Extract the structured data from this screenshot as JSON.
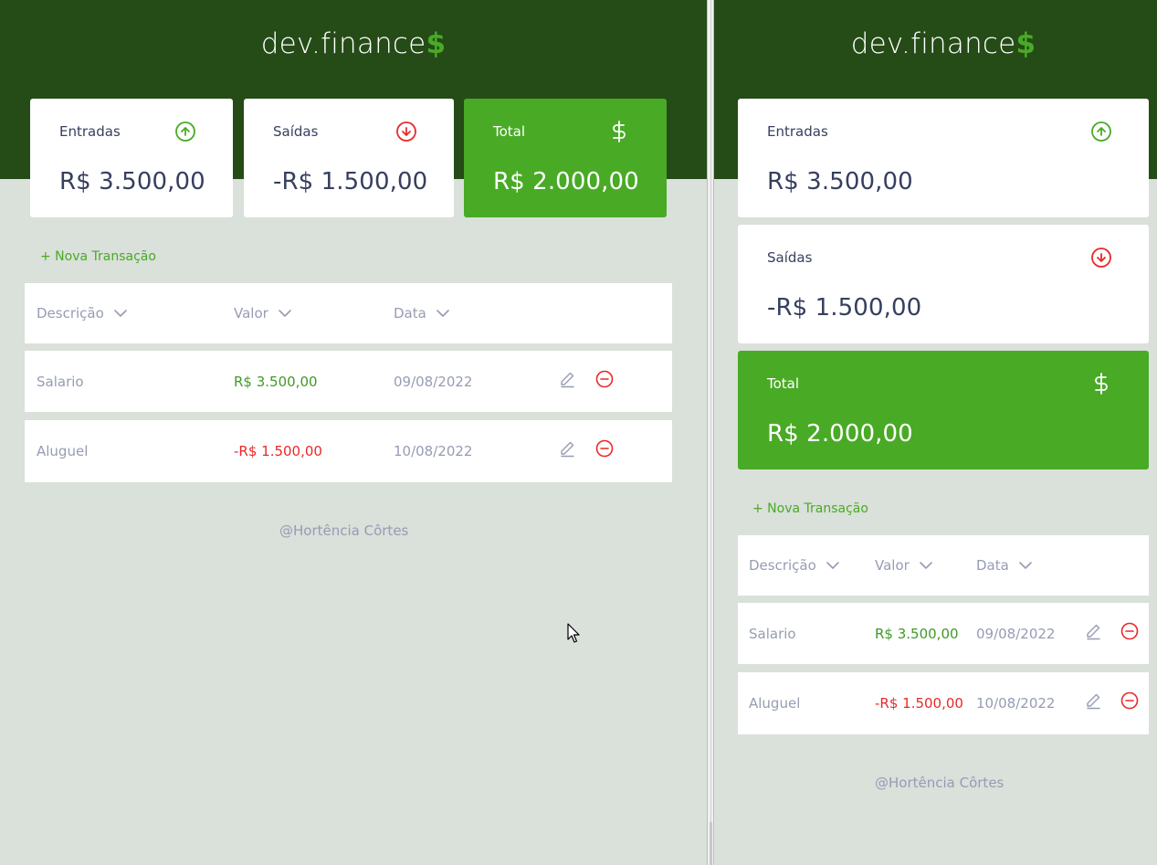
{
  "app": {
    "logo_text": "dev.finance",
    "logo_symbol": "$"
  },
  "summary": {
    "income": {
      "label": "Entradas",
      "value": "R$ 3.500,00",
      "icon": "arrow-up-circle-icon"
    },
    "expense": {
      "label": "Saídas",
      "value": "-R$ 1.500,00",
      "icon": "arrow-down-circle-icon"
    },
    "total": {
      "label": "Total",
      "value": "R$ 2.000,00",
      "icon": "dollar-icon"
    }
  },
  "actions": {
    "new_transaction": "+ Nova Transação"
  },
  "table": {
    "columns": [
      "Descrição",
      "Valor",
      "Data"
    ],
    "rows": [
      {
        "description": "Salario",
        "amount": "R$ 3.500,00",
        "date": "09/08/2022",
        "type": "income"
      },
      {
        "description": "Aluguel",
        "amount": "-R$ 1.500,00",
        "date": "10/08/2022",
        "type": "expense"
      }
    ],
    "row_actions": [
      "edit-pencil-icon",
      "remove-minus-circle-icon"
    ]
  },
  "footer": {
    "text": "@Hortência Côrtes"
  },
  "colors": {
    "header": "#254b17",
    "accent": "#49aa26",
    "income": "#3f9a25",
    "expense": "#e92929",
    "background": "#dae0da",
    "muted_text": "#969cb3",
    "value_text": "#363f5f"
  }
}
